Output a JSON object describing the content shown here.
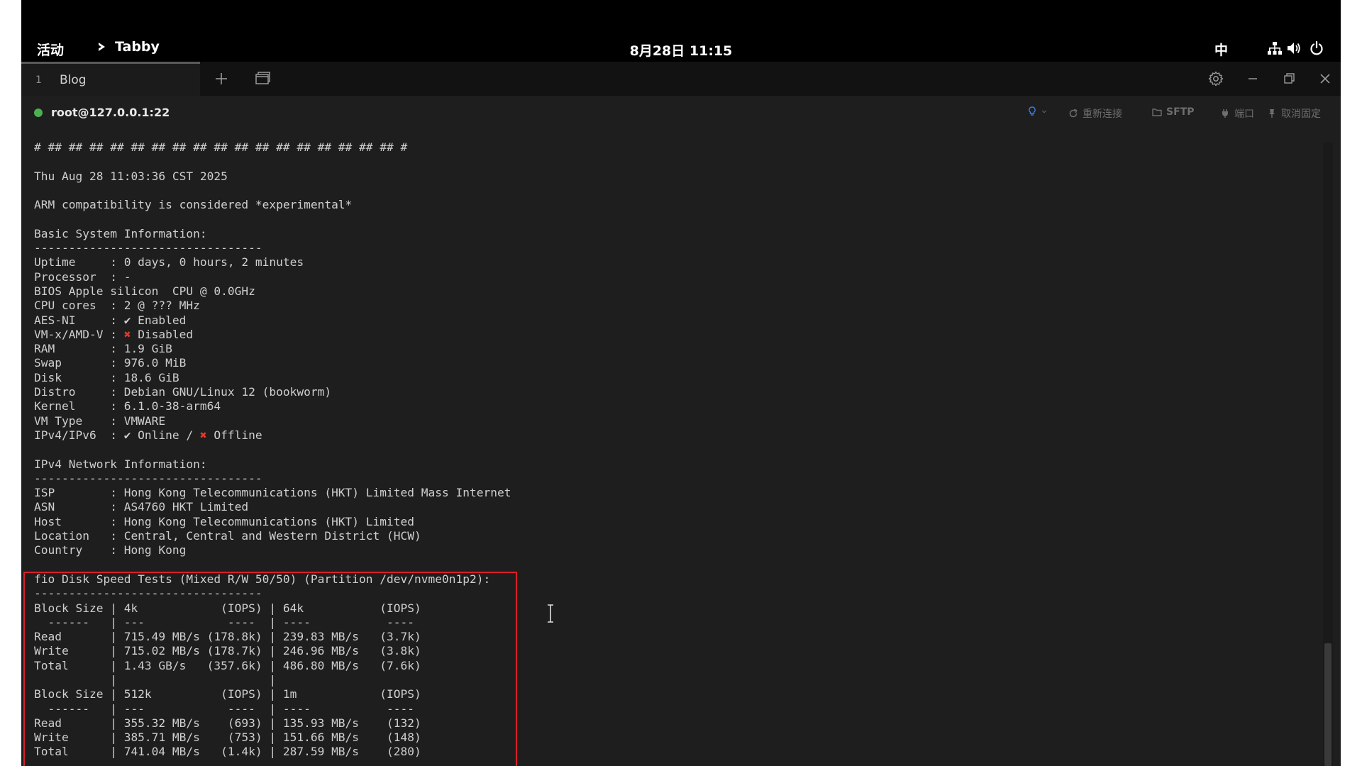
{
  "topbar": {
    "activities": "活动",
    "app_name": "Tabby",
    "clock": "8月28日 11:15",
    "ime": "中",
    "icons": [
      "network-icon",
      "volume-icon",
      "power-icon"
    ]
  },
  "tabs": [
    {
      "number": "1",
      "title": "Blog",
      "active": true
    }
  ],
  "tabbar_icons": [
    "plus-icon",
    "window-icon",
    "gear-icon",
    "minimize-icon",
    "restore-icon",
    "close-icon"
  ],
  "session": {
    "host": "root@127.0.0.1:22",
    "status_color": "#4caf50",
    "actions": {
      "reconnect": "重新连接",
      "sftp": "SFTP",
      "ports": "端口",
      "unpin": "取消固定"
    }
  },
  "terminal": {
    "lines": [
      "# ## ## ## ## ## ## ## ## ## ## ## ## ## ## ## ## ## #",
      "",
      "Thu Aug 28 11:03:36 CST 2025",
      "",
      "ARM compatibility is considered *experimental*",
      "",
      "Basic System Information:",
      "---------------------------------",
      "Uptime     : 0 days, 0 hours, 2 minutes",
      "Processor  : -",
      "BIOS Apple silicon  CPU @ 0.0GHz",
      "CPU cores  : 2 @ ??? MHz",
      "AES-NI     : ✔ Enabled",
      "VM-x/AMD-V : ❌ Disabled",
      "RAM        : 1.9 GiB",
      "Swap       : 976.0 MiB",
      "Disk       : 18.6 GiB",
      "Distro     : Debian GNU/Linux 12 (bookworm)",
      "Kernel     : 6.1.0-38-arm64",
      "VM Type    : VMWARE",
      "IPv4/IPv6  : ✔ Online / ❌ Offline",
      "",
      "IPv4 Network Information:",
      "---------------------------------",
      "ISP        : Hong Kong Telecommunications (HKT) Limited Mass Internet",
      "ASN        : AS4760 HKT Limited",
      "Host       : Hong Kong Telecommunications (HKT) Limited",
      "Location   : Central, Central and Western District (HCW)",
      "Country    : Hong Kong",
      "",
      "fio Disk Speed Tests (Mixed R/W 50/50) (Partition /dev/nvme0n1p2):",
      "---------------------------------",
      "Block Size | 4k            (IOPS) | 64k           (IOPS)",
      "  ------   | ---            ----  | ----           ---- ",
      "Read       | 715.49 MB/s (178.8k) | 239.83 MB/s   (3.7k)",
      "Write      | 715.02 MB/s (178.7k) | 246.96 MB/s   (3.8k)",
      "Total      | 1.43 GB/s   (357.6k) | 486.80 MB/s   (7.6k)",
      "           |                      |                     ",
      "Block Size | 512k          (IOPS) | 1m            (IOPS)",
      "  ------   | ---            ----  | ----           ---- ",
      "Read       | 355.32 MB/s    (693) | 135.93 MB/s    (132)",
      "Write      | 385.71 MB/s    (753) | 151.66 MB/s    (148)",
      "Total      | 741.04 MB/s   (1.4k) | 287.59 MB/s    (280)"
    ]
  },
  "highlight_color": "#d81f2a"
}
